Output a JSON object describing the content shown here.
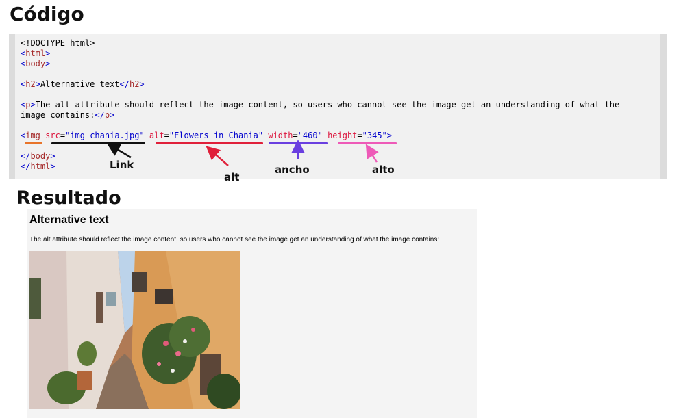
{
  "headings": {
    "code": "Código",
    "result": "Resultado"
  },
  "code": {
    "doctype": "<!DOCTYPE html>",
    "html_open": "html",
    "body_open": "body",
    "h2_tag": "h2",
    "h2_text": "Alternative text",
    "p_tag": "p",
    "p_text_1": "The alt attribute should reflect the image content, so users who cannot see the image get an understanding of what the",
    "p_text_2": "image contains:",
    "img_tag": "img",
    "attr_src": "src",
    "val_src": "\"img_chania.jpg\"",
    "attr_alt": "alt",
    "val_alt": "\"Flowers in Chania\"",
    "attr_width": "width",
    "val_width": "\"460\"",
    "attr_height": "height",
    "val_height": "\"345\"",
    "body_close": "body",
    "html_close": "html"
  },
  "annotations": {
    "link": "Link",
    "alt": "alt",
    "ancho": "ancho",
    "alto": "alto"
  },
  "colors": {
    "orange": "#e8742a",
    "black": "#111111",
    "red": "#e0203a",
    "purple": "#6a3fe0",
    "pink": "#ee5ab8"
  },
  "result": {
    "h2": "Alternative text",
    "p": "The alt attribute should reflect the image content, so users who cannot see the image get an understanding of what the image contains:",
    "img_alt": "Flowers in Chania"
  }
}
